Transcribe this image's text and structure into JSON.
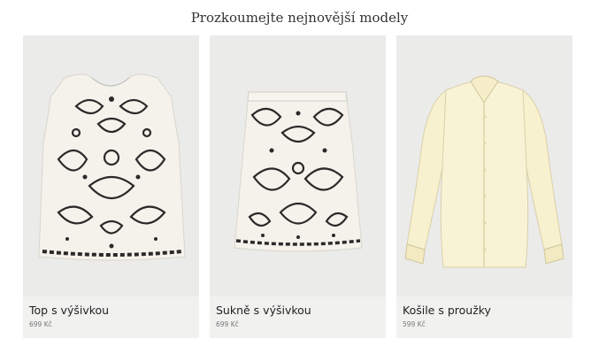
{
  "section": {
    "title": "Prozkoumejte nejnovější modely"
  },
  "products": [
    {
      "name": "Top s výšivkou",
      "price": "699 Kč",
      "image_icon": "embroidered-top-image"
    },
    {
      "name": "Sukně s výšivkou",
      "price": "699 Kč",
      "image_icon": "embroidered-skirt-image"
    },
    {
      "name": "Košile s proužky",
      "price": "599 Kč",
      "image_icon": "striped-shirt-image"
    }
  ],
  "colors": {
    "card_bg": "#ededec",
    "garment_white": "#f4f2ea",
    "embroidery": "#2a2a2a",
    "shirt_yellow": "#f8f1cf"
  }
}
